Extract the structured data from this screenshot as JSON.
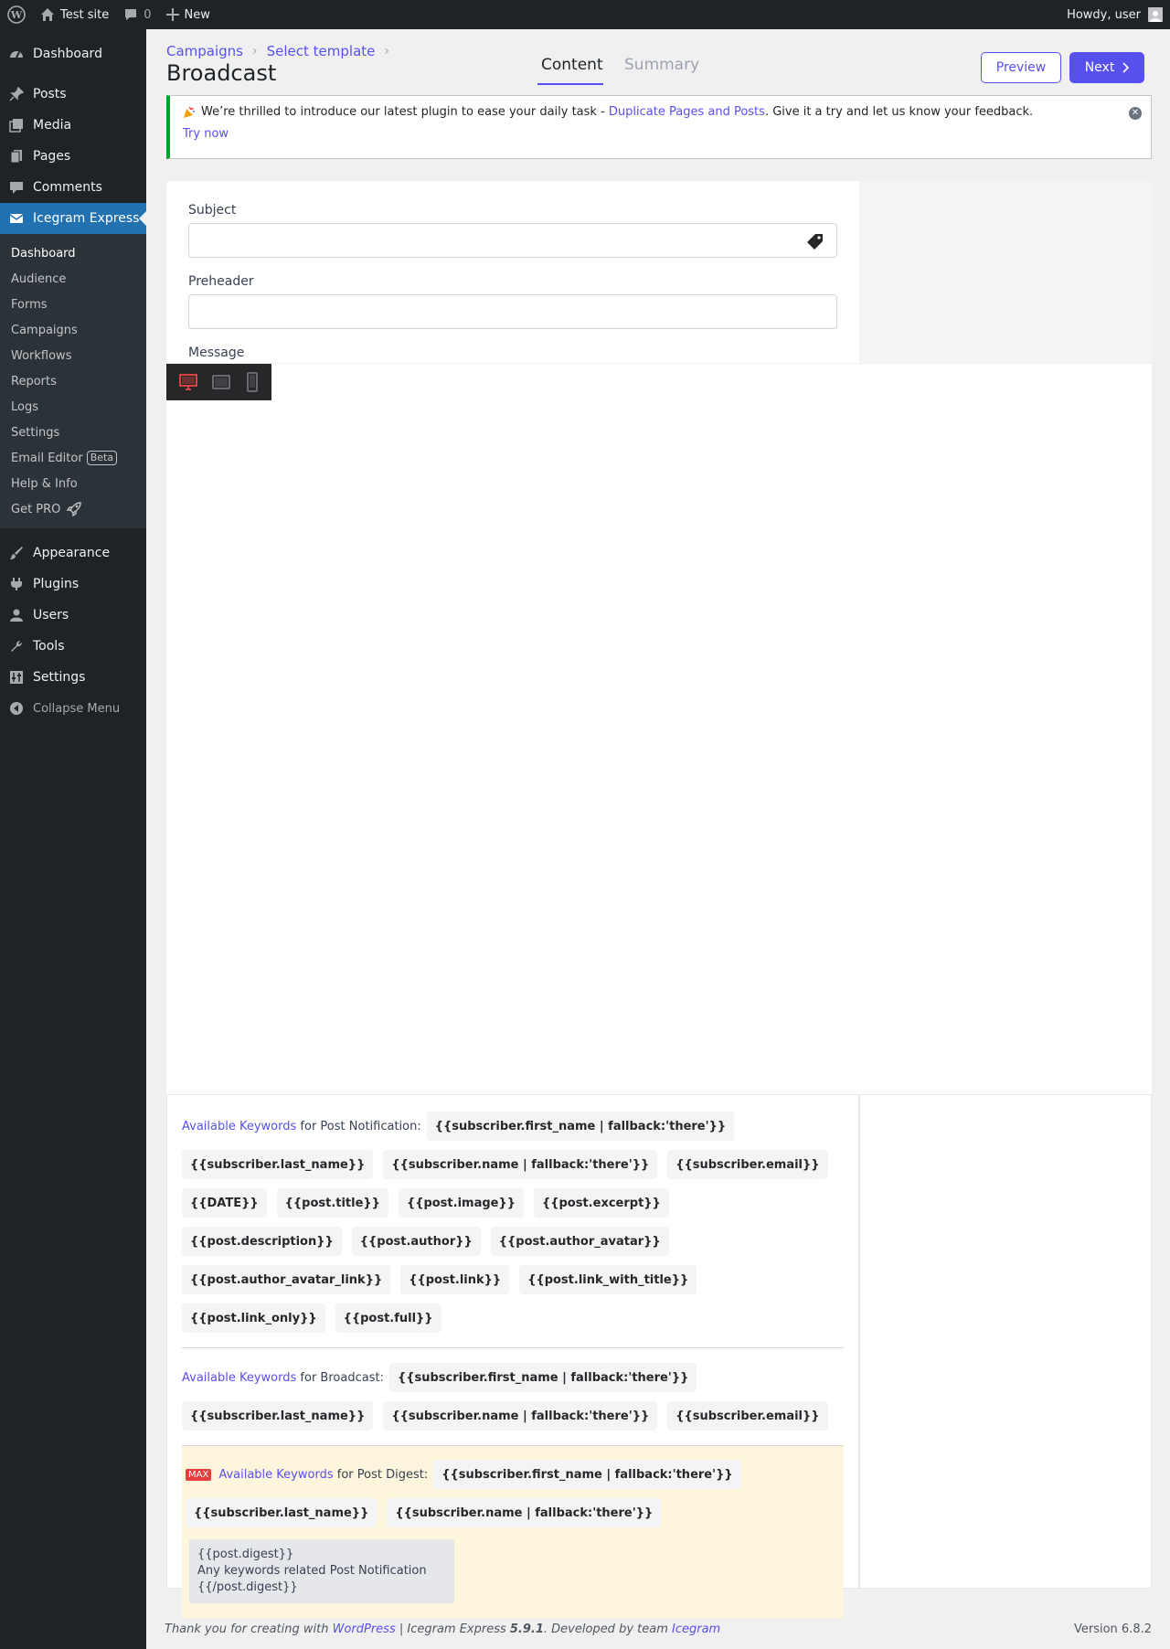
{
  "adminbar": {
    "site_name": "Test site",
    "comments_count": "0",
    "new_label": "New",
    "howdy": "Howdy, user"
  },
  "sidebar": {
    "items_top": [
      {
        "label": "Dashboard",
        "icon": "dashboard-icon"
      }
    ],
    "items_main": [
      {
        "label": "Posts",
        "icon": "pin-icon"
      },
      {
        "label": "Media",
        "icon": "media-icon"
      },
      {
        "label": "Pages",
        "icon": "page-icon"
      },
      {
        "label": "Comments",
        "icon": "comment-icon"
      }
    ],
    "current": {
      "label": "Icegram Express",
      "icon": "mail-icon"
    },
    "submenu": [
      "Dashboard",
      "Audience",
      "Forms",
      "Campaigns",
      "Workflows",
      "Reports",
      "Logs",
      "Settings",
      "Email Editor",
      "Help & Info",
      "Get PRO"
    ],
    "beta_label": "Beta",
    "items_bottom": [
      {
        "label": "Appearance",
        "icon": "brush-icon"
      },
      {
        "label": "Plugins",
        "icon": "plug-icon"
      },
      {
        "label": "Users",
        "icon": "user-icon"
      },
      {
        "label": "Tools",
        "icon": "wrench-icon"
      },
      {
        "label": "Settings",
        "icon": "settings-icon"
      }
    ],
    "collapse_label": "Collapse Menu"
  },
  "header": {
    "breadcrumb": [
      "Campaigns",
      "Select template"
    ],
    "title": "Broadcast",
    "tabs": [
      "Content",
      "Summary"
    ],
    "preview_label": "Preview",
    "next_label": "Next"
  },
  "notice": {
    "text_before": "We’re thrilled to introduce our latest plugin to ease your daily task - ",
    "link_text": "Duplicate Pages and Posts",
    "text_after": ". Give it a try and let us know your feedback.",
    "try_label": "Try now"
  },
  "form": {
    "subject_label": "Subject",
    "subject_value": "",
    "preheader_label": "Preheader",
    "preheader_value": "",
    "message_label": "Message"
  },
  "keywords": {
    "available_link": "Available Keywords",
    "post_notification": {
      "lead": "for Post Notification:",
      "chips": [
        "{{subscriber.first_name | fallback:'there'}}",
        "{{subscriber.last_name}}",
        "{{subscriber.name | fallback:'there'}}",
        "{{subscriber.email}}",
        "{{DATE}}",
        "{{post.title}}",
        "{{post.image}}",
        "{{post.excerpt}}",
        "{{post.description}}",
        "{{post.author}}",
        "{{post.author_avatar}}",
        "{{post.author_avatar_link}}",
        "{{post.link}}",
        "{{post.link_with_title}}",
        "{{post.link_only}}",
        "{{post.full}}"
      ]
    },
    "broadcast": {
      "lead": "for Broadcast:",
      "chips": [
        "{{subscriber.first_name | fallback:'there'}}",
        "{{subscriber.last_name}}",
        "{{subscriber.name | fallback:'there'}}",
        "{{subscriber.email}}"
      ]
    },
    "digest": {
      "badge": "MAX",
      "lead": "for Post Digest:",
      "chips": [
        "{{subscriber.first_name | fallback:'there'}}",
        "{{subscriber.last_name}}",
        "{{subscriber.name | fallback:'there'}}"
      ],
      "block_lines": [
        "{{post.digest}}",
        "Any keywords related Post Notification",
        "{{/post.digest}}"
      ]
    }
  },
  "footer": {
    "text1": "Thank you for creating with ",
    "wp_link": "WordPress",
    "text2": " | Icegram Express ",
    "version_bold": "5.9.1",
    "text3": ". Developed by team ",
    "icegram_link": "Icegram",
    "version": "Version 6.8.2"
  },
  "colors": {
    "accent": "#5850ec",
    "admin_dark": "#1d2327",
    "current_menu": "#2271b1",
    "notice_green": "#00a32a"
  }
}
